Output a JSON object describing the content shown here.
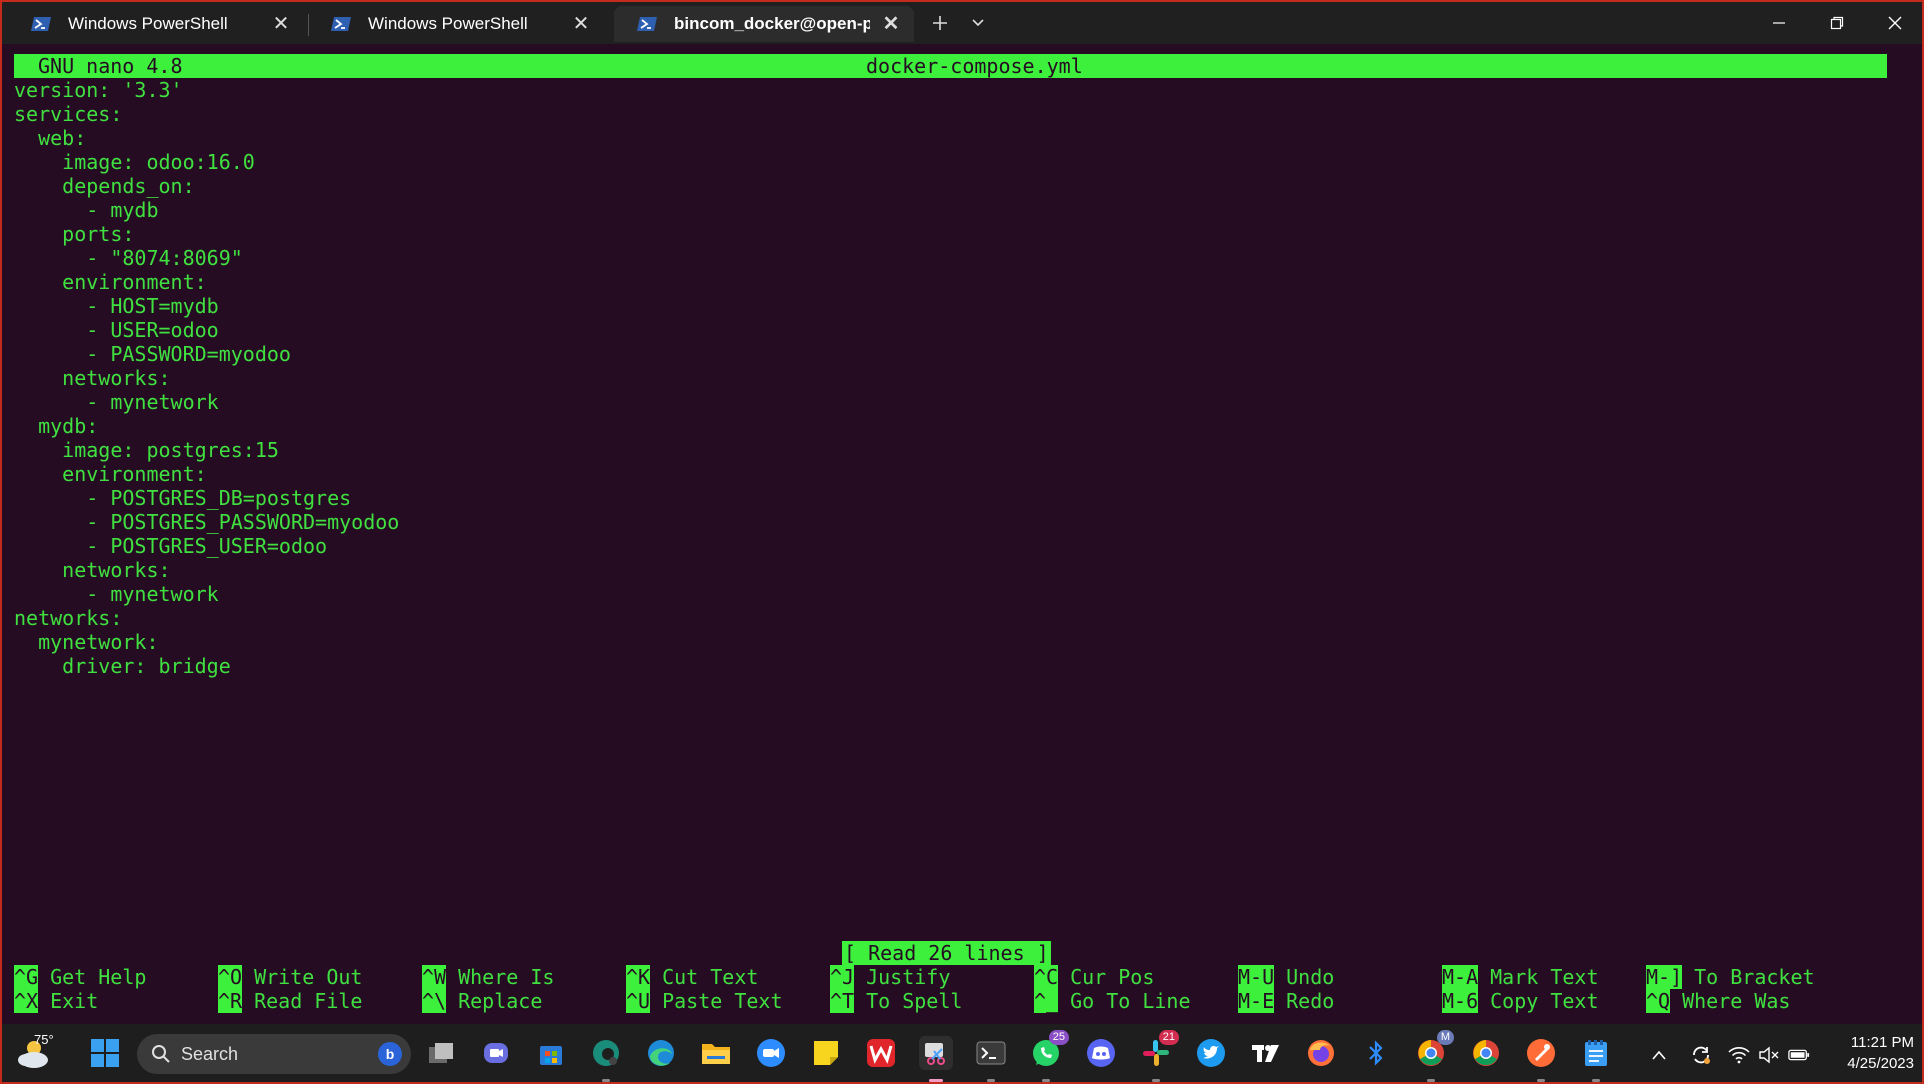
{
  "tabs": [
    {
      "label": "Windows PowerShell"
    },
    {
      "label": "Windows PowerShell"
    },
    {
      "label": "bincom_docker@open-projec"
    }
  ],
  "nano": {
    "version": "GNU nano 4.8",
    "filename": "docker-compose.yml",
    "status": "[ Read 26 lines ]"
  },
  "code_lines": [
    "version: '3.3'",
    "services:",
    "  web:",
    "    image: odoo:16.0",
    "    depends_on:",
    "      - mydb",
    "    ports:",
    "      - \"8074:8069\"",
    "    environment:",
    "      - HOST=mydb",
    "      - USER=odoo",
    "      - PASSWORD=myodoo",
    "    networks:",
    "      - mynetwork",
    "  mydb:",
    "    image: postgres:15",
    "    environment:",
    "      - POSTGRES_DB=postgres",
    "      - POSTGRES_PASSWORD=myodoo",
    "      - POSTGRES_USER=odoo",
    "    networks:",
    "      - mynetwork",
    "networks:",
    "  mynetwork:",
    "    driver: bridge"
  ],
  "shortcuts": [
    {
      "key": "^G",
      "label": "Get Help"
    },
    {
      "key": "^X",
      "label": "Exit"
    },
    {
      "key": "^O",
      "label": "Write Out"
    },
    {
      "key": "^R",
      "label": "Read File"
    },
    {
      "key": "^W",
      "label": "Where Is"
    },
    {
      "key": "^\\",
      "label": "Replace"
    },
    {
      "key": "^K",
      "label": "Cut Text"
    },
    {
      "key": "^U",
      "label": "Paste Text"
    },
    {
      "key": "^J",
      "label": "Justify"
    },
    {
      "key": "^T",
      "label": "To Spell"
    },
    {
      "key": "^C",
      "label": "Cur Pos"
    },
    {
      "key": "^_",
      "label": "Go To Line"
    },
    {
      "key": "M-U",
      "label": "Undo"
    },
    {
      "key": "M-E",
      "label": "Redo"
    },
    {
      "key": "M-A",
      "label": "Mark Text"
    },
    {
      "key": "M-6",
      "label": "Copy Text"
    },
    {
      "key": "M-]",
      "label": "To Bracket"
    },
    {
      "key": "^Q",
      "label": "Where Was"
    }
  ],
  "taskbar": {
    "weather_temp": "75°",
    "search_label": "Search",
    "whatsapp_badge": "25",
    "slack_badge": "21",
    "chrome_profile_badge": "M",
    "time": "11:21 PM",
    "date": "4/25/2023"
  },
  "colors": {
    "terminal_bg": "#250c22",
    "nano_green": "#3cf03c",
    "text_green": "#40e040",
    "window_border": "#c42b1c"
  }
}
